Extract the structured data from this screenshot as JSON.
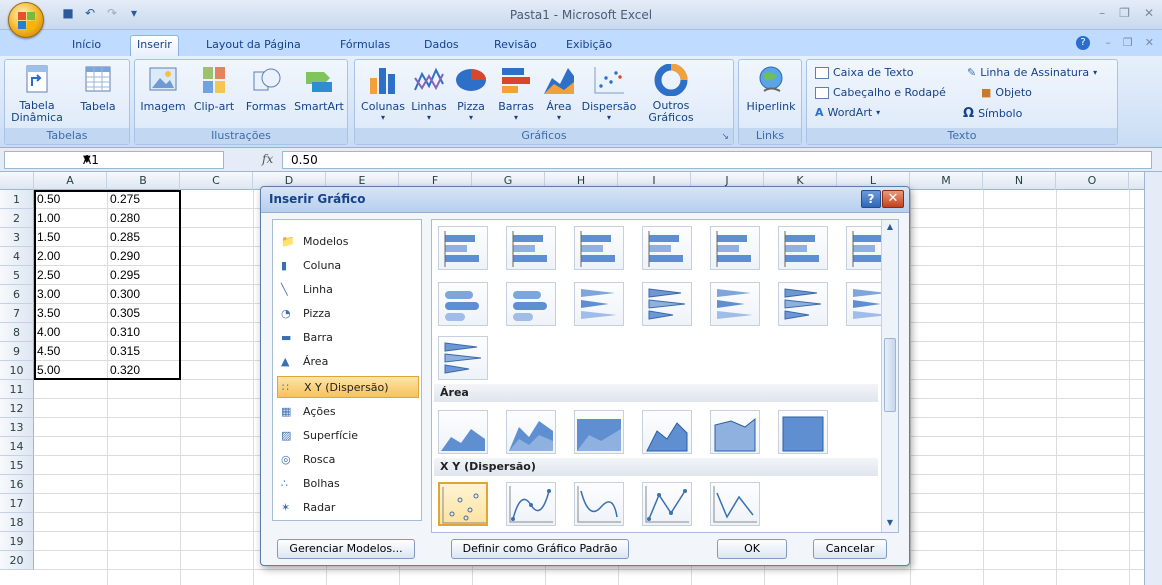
{
  "window": {
    "title": "Pasta1 - Microsoft Excel"
  },
  "ribbon_tabs": [
    "Início",
    "Inserir",
    "Layout da Página",
    "Fórmulas",
    "Dados",
    "Revisão",
    "Exibição"
  ],
  "active_tab": "Inserir",
  "groups": {
    "tabelas": {
      "label": "Tabelas",
      "items": [
        "Tabela\nDinâmica",
        "Tabela"
      ]
    },
    "ilustracoes": {
      "label": "Ilustrações",
      "items": [
        "Imagem",
        "Clip-art",
        "Formas",
        "SmartArt"
      ]
    },
    "graficos": {
      "label": "Gráficos",
      "items": [
        "Colunas",
        "Linhas",
        "Pizza",
        "Barras",
        "Área",
        "Dispersão",
        "Outros\nGráficos"
      ]
    },
    "links": {
      "label": "Links",
      "items": [
        "Hiperlink"
      ]
    },
    "texto": {
      "label": "Texto",
      "items": [
        "Caixa de Texto",
        "Cabeçalho e Rodapé",
        "WordArt",
        "Linha de Assinatura",
        "Objeto",
        "Símbolo"
      ]
    }
  },
  "formula_bar": {
    "name_box": "A1",
    "fx": "fx",
    "value": "0.50"
  },
  "columns": [
    "A",
    "B",
    "C",
    "D",
    "E",
    "F",
    "G",
    "H",
    "I",
    "J",
    "K",
    "L",
    "M",
    "N",
    "O"
  ],
  "rows": [
    "1",
    "2",
    "3",
    "4",
    "5",
    "6",
    "7",
    "8",
    "9",
    "10",
    "11",
    "12",
    "13",
    "14",
    "15",
    "16",
    "17",
    "18",
    "19",
    "20"
  ],
  "cells": {
    "A": [
      "0.50",
      "1.00",
      "1.50",
      "2.00",
      "2.50",
      "3.00",
      "3.50",
      "4.00",
      "4.50",
      "5.00"
    ],
    "B": [
      "0.275",
      "0.280",
      "0.285",
      "0.290",
      "0.295",
      "0.300",
      "0.305",
      "0.310",
      "0.315",
      "0.320"
    ]
  },
  "dialog": {
    "title": "Inserir Gráfico",
    "chart_types": [
      "Modelos",
      "Coluna",
      "Linha",
      "Pizza",
      "Barra",
      "Área",
      "X Y (Dispersão)",
      "Ações",
      "Superfície",
      "Rosca",
      "Bolhas",
      "Radar"
    ],
    "selected_type": "X Y (Dispersão)",
    "sections": {
      "area": "Área",
      "scatter": "X Y (Dispersão)"
    },
    "buttons": {
      "manage": "Gerenciar Modelos...",
      "default": "Definir como Gráfico Padrão",
      "ok": "OK",
      "cancel": "Cancelar"
    }
  }
}
